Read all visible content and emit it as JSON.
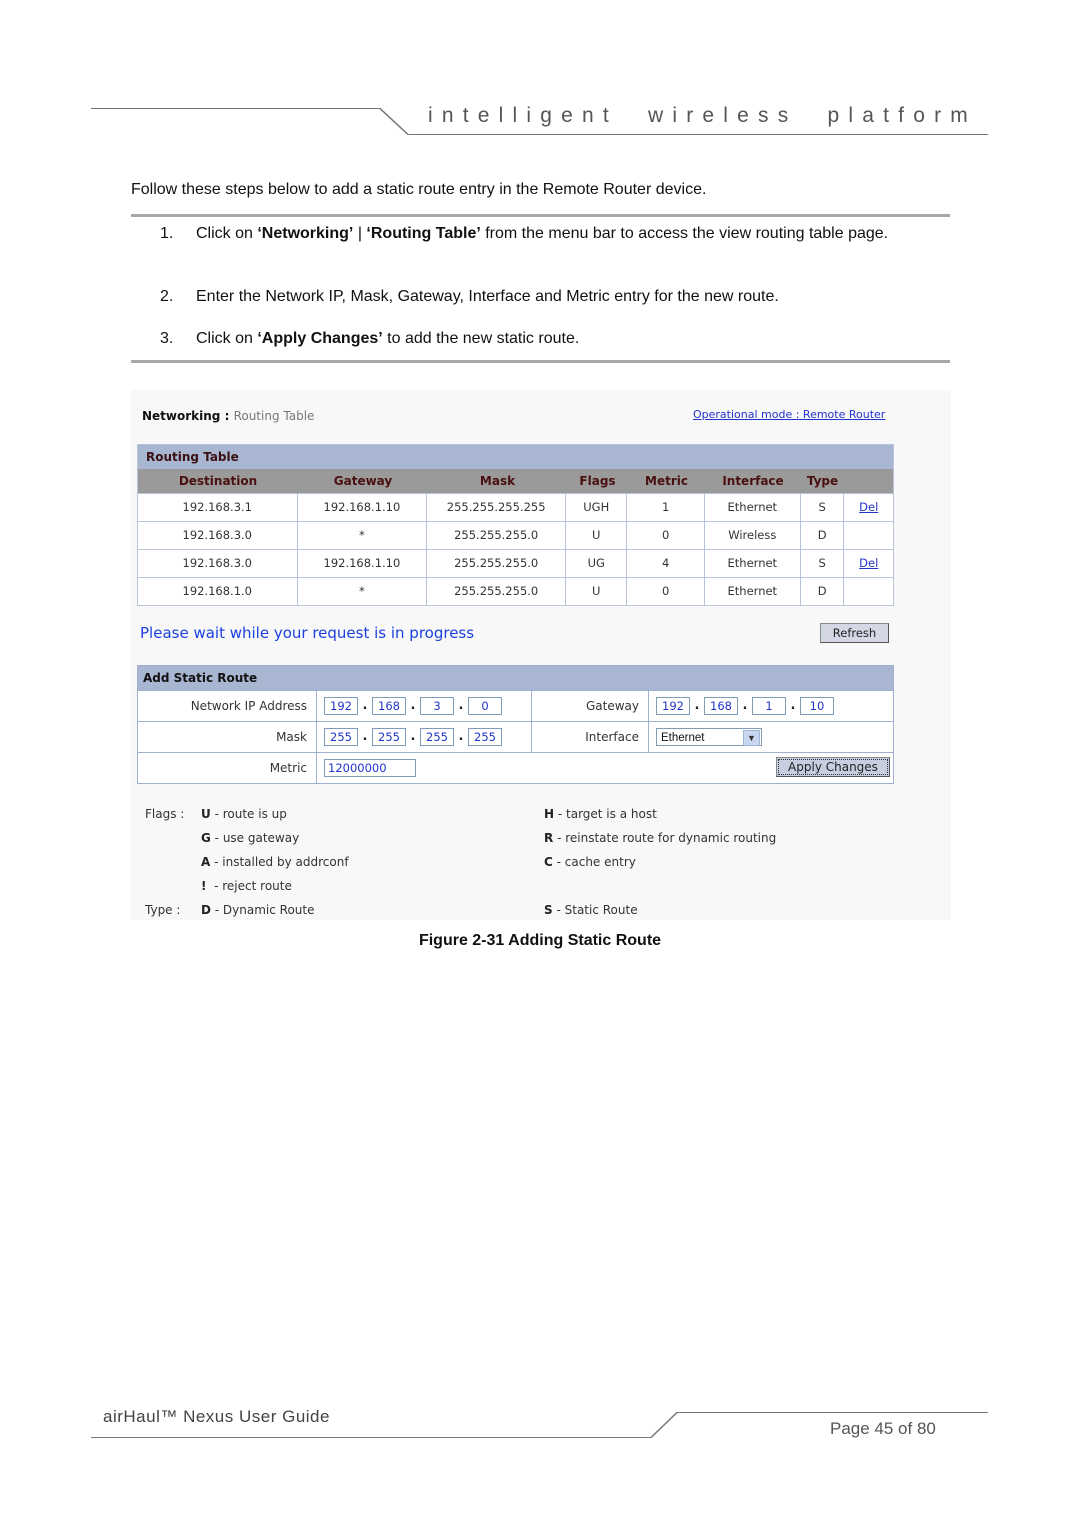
{
  "header": {
    "tagline": "intelligent  wireless  platform"
  },
  "intro": "Follow these steps below to add a static route entry in the Remote Router device.",
  "steps": [
    {
      "num": "1.",
      "pre": "Click on ",
      "b1": "‘Networking’",
      "mid": " | ",
      "b2": "‘Routing Table’",
      "post": " from the menu bar to access the view routing table page."
    },
    {
      "num": "2.",
      "text": "Enter the Network IP, Mask, Gateway, Interface and Metric entry for the new route."
    },
    {
      "num": "3.",
      "pre": "Click on ",
      "b1": "‘Apply Changes’",
      "post": " to add the new static route."
    }
  ],
  "screenshot": {
    "breadcrumb": {
      "section": "Networking :",
      "page": "Routing Table"
    },
    "op_mode_link": "Operational mode : Remote Router",
    "routing_table": {
      "title": "Routing Table",
      "columns": [
        "Destination",
        "Gateway",
        "Mask",
        "Flags",
        "Metric",
        "Interface",
        "Type",
        ""
      ],
      "rows": [
        {
          "destination": "192.168.3.1",
          "gateway": "192.168.1.10",
          "mask": "255.255.255.255",
          "flags": "UGH",
          "metric": "1",
          "interface": "Ethernet",
          "type": "S",
          "action": "Del"
        },
        {
          "destination": "192.168.3.0",
          "gateway": "*",
          "mask": "255.255.255.0",
          "flags": "U",
          "metric": "0",
          "interface": "Wireless",
          "type": "D",
          "action": ""
        },
        {
          "destination": "192.168.3.0",
          "gateway": "192.168.1.10",
          "mask": "255.255.255.0",
          "flags": "UG",
          "metric": "4",
          "interface": "Ethernet",
          "type": "S",
          "action": "Del"
        },
        {
          "destination": "192.168.1.0",
          "gateway": "*",
          "mask": "255.255.255.0",
          "flags": "U",
          "metric": "0",
          "interface": "Ethernet",
          "type": "D",
          "action": ""
        }
      ]
    },
    "status_message": "Please wait while your request is in progress",
    "refresh_label": "Refresh",
    "add_static_route": {
      "title": "Add Static Route",
      "network_ip_label": "Network IP Address",
      "network_ip": [
        "192",
        "168",
        "3",
        "0"
      ],
      "gateway_label": "Gateway",
      "gateway": [
        "192",
        "168",
        "1",
        "10"
      ],
      "mask_label": "Mask",
      "mask": [
        "255",
        "255",
        "255",
        "255"
      ],
      "interface_label": "Interface",
      "interface_value": "Ethernet",
      "metric_label": "Metric",
      "metric_value": "12000000",
      "apply_label": "Apply Changes"
    },
    "legend": {
      "flags_label": "Flags :",
      "type_label": "Type :",
      "flags_left": [
        {
          "key": "U",
          "desc": " - route is up"
        },
        {
          "key": "G",
          "desc": " - use gateway"
        },
        {
          "key": "A",
          "desc": " - installed by addrconf"
        },
        {
          "key": "!",
          "desc": "  - reject route"
        }
      ],
      "flags_right": [
        {
          "key": "H",
          "desc": " - target is a host"
        },
        {
          "key": "R",
          "desc": " - reinstate route for dynamic routing"
        },
        {
          "key": "C",
          "desc": " - cache entry"
        }
      ],
      "types": [
        {
          "key": "D",
          "desc": " - Dynamic Route"
        },
        {
          "key": "S",
          "desc": " - Static Route"
        }
      ]
    }
  },
  "caption": "Figure 2-31 Adding Static Route",
  "footer": {
    "title": "airHaul™ Nexus User Guide",
    "page": "Page 45 of 80"
  }
}
